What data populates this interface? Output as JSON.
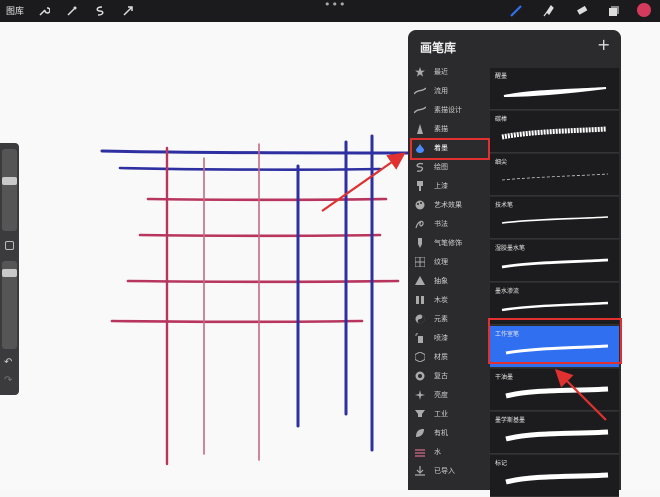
{
  "topbar": {
    "gallery_label": "图库",
    "colors": {
      "accent": "#2f6ff0",
      "color_swatch": "#d43a5c"
    }
  },
  "panel": {
    "title": "画笔库",
    "add_label": "+",
    "categories": [
      {
        "label": "最近",
        "icon": "star-icon"
      },
      {
        "label": "流用",
        "icon": "wave-icon"
      },
      {
        "label": "素描设计",
        "icon": "wave-icon"
      },
      {
        "label": "素描",
        "icon": "pencil-icon"
      },
      {
        "label": "着墨",
        "icon": "ink-drop-icon"
      },
      {
        "label": "绘图",
        "icon": "swirl-icon"
      },
      {
        "label": "上漆",
        "icon": "paint-brush-icon"
      },
      {
        "label": "艺术效果",
        "icon": "palette-icon"
      },
      {
        "label": "书法",
        "icon": "calligraphy-icon"
      },
      {
        "label": "气笔修饰",
        "icon": "airbrush-icon"
      },
      {
        "label": "纹理",
        "icon": "texture-icon"
      },
      {
        "label": "抽象",
        "icon": "triangle-icon"
      },
      {
        "label": "木炭",
        "icon": "charcoal-icon"
      },
      {
        "label": "元素",
        "icon": "yin-yang-icon"
      },
      {
        "label": "喷漆",
        "icon": "spray-icon"
      },
      {
        "label": "材质",
        "icon": "cube-icon"
      },
      {
        "label": "复古",
        "icon": "retro-icon"
      },
      {
        "label": "亮度",
        "icon": "sparkle-icon"
      },
      {
        "label": "工业",
        "icon": "anvil-icon"
      },
      {
        "label": "有机",
        "icon": "leaf-icon"
      },
      {
        "label": "水",
        "icon": "water-icon"
      },
      {
        "label": "已导入",
        "icon": "import-icon"
      }
    ],
    "brushes": [
      {
        "name": "醒墨"
      },
      {
        "name": "碳棒"
      },
      {
        "name": "细尖"
      },
      {
        "name": "技术笔"
      },
      {
        "name": "湿胶墨水笔"
      },
      {
        "name": "墨水渗流"
      },
      {
        "name": "工作室笔"
      },
      {
        "name": "干油墨"
      },
      {
        "name": "墨学斯基墨"
      },
      {
        "name": "标记"
      }
    ]
  }
}
